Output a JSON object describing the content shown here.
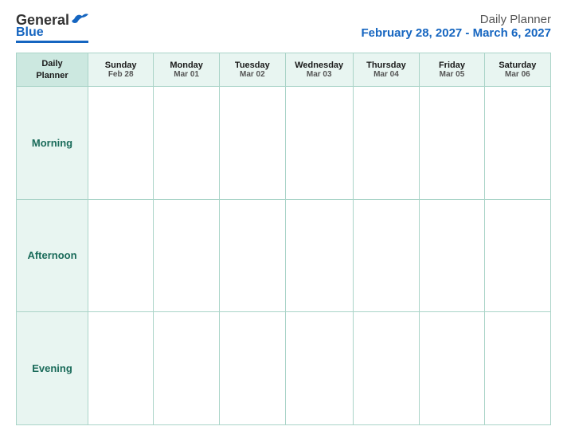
{
  "logo": {
    "text_general": "General",
    "text_blue": "Blue"
  },
  "header": {
    "title": "Daily Planner",
    "date_range": "February 28, 2027 - March 6, 2027"
  },
  "columns": [
    {
      "id": "label",
      "top": "Daily",
      "sub": "Planner",
      "is_label": true
    },
    {
      "id": "sunday",
      "top": "Sunday",
      "sub": "Feb 28",
      "weekend": true
    },
    {
      "id": "monday",
      "top": "Monday",
      "sub": "Mar 01",
      "weekend": false
    },
    {
      "id": "tuesday",
      "top": "Tuesday",
      "sub": "Mar 02",
      "weekend": false
    },
    {
      "id": "wednesday",
      "top": "Wednesday",
      "sub": "Mar 03",
      "weekend": false
    },
    {
      "id": "thursday",
      "top": "Thursday",
      "sub": "Mar 04",
      "weekend": false
    },
    {
      "id": "friday",
      "top": "Friday",
      "sub": "Mar 05",
      "weekend": false
    },
    {
      "id": "saturday",
      "top": "Saturday",
      "sub": "Mar 06",
      "weekend": true
    }
  ],
  "rows": [
    {
      "id": "morning",
      "label": "Morning"
    },
    {
      "id": "afternoon",
      "label": "Afternoon"
    },
    {
      "id": "evening",
      "label": "Evening"
    }
  ]
}
